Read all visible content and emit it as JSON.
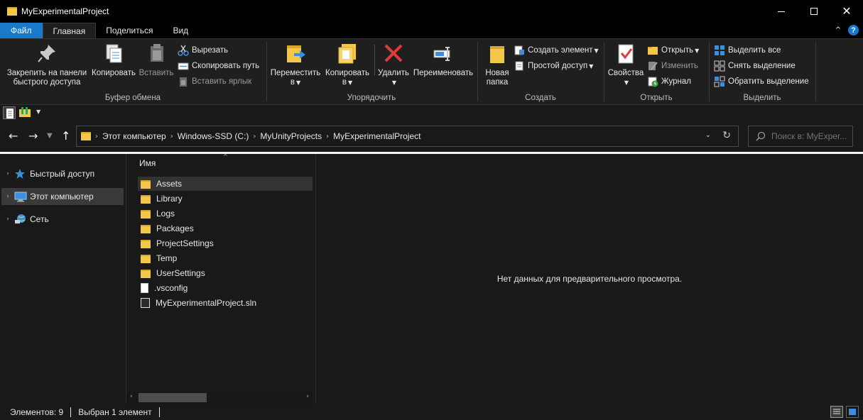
{
  "window": {
    "title": "MyExperimentalProject"
  },
  "tabs": [
    {
      "label": "Файл"
    },
    {
      "label": "Главная"
    },
    {
      "label": "Поделиться"
    },
    {
      "label": "Вид"
    }
  ],
  "ribbon": {
    "clipboard": {
      "label": "Буфер обмена",
      "pin": "Закрепить на панели быстрого доступа",
      "pin_line1": "Закрепить на панели",
      "pin_line2": "быстрого доступа",
      "copy": "Копировать",
      "paste": "Вставить",
      "cut": "Вырезать",
      "copy_path": "Скопировать путь",
      "paste_shortcut": "Вставить ярлык"
    },
    "organize": {
      "label": "Упорядочить",
      "move_line1": "Переместить",
      "move_line2": "в",
      "copyto_line1": "Копировать",
      "copyto_line2": "в",
      "delete": "Удалить",
      "rename": "Переименовать"
    },
    "new": {
      "label": "Создать",
      "folder_line1": "Новая",
      "folder_line2": "папка",
      "new_item": "Создать элемент",
      "easy_access": "Простой доступ"
    },
    "open": {
      "label": "Открыть",
      "properties": "Свойства",
      "open": "Открыть",
      "edit": "Изменить",
      "history": "Журнал"
    },
    "select": {
      "label": "Выделить",
      "select_all": "Выделить все",
      "select_none": "Снять выделение",
      "invert": "Обратить выделение"
    }
  },
  "address": {
    "crumbs": [
      "Этот компьютер",
      "Windows-SSD (C:)",
      "MyUnityProjects",
      "MyExperimentalProject"
    ],
    "search_placeholder": "Поиск в: MyExper..."
  },
  "nav": {
    "items": [
      {
        "label": "Быстрый доступ",
        "icon": "star-icon"
      },
      {
        "label": "Этот компьютер",
        "icon": "computer-icon",
        "selected": true
      },
      {
        "label": "Сеть",
        "icon": "network-icon"
      }
    ]
  },
  "files": {
    "column": "Имя",
    "items": [
      {
        "name": "Assets",
        "type": "folder",
        "selected": true
      },
      {
        "name": "Library",
        "type": "folder"
      },
      {
        "name": "Logs",
        "type": "folder"
      },
      {
        "name": "Packages",
        "type": "folder"
      },
      {
        "name": "ProjectSettings",
        "type": "folder"
      },
      {
        "name": "Temp",
        "type": "folder"
      },
      {
        "name": "UserSettings",
        "type": "folder"
      },
      {
        "name": ".vsconfig",
        "type": "file"
      },
      {
        "name": "MyExperimentalProject.sln",
        "type": "sln"
      }
    ]
  },
  "preview": {
    "message": "Нет данных для предварительного просмотра."
  },
  "status": {
    "count": "Элементов: 9",
    "selected": "Выбран 1 элемент"
  },
  "colors": {
    "accent": "#1979ca",
    "folder": "#f3c84a",
    "background": "#191919"
  }
}
